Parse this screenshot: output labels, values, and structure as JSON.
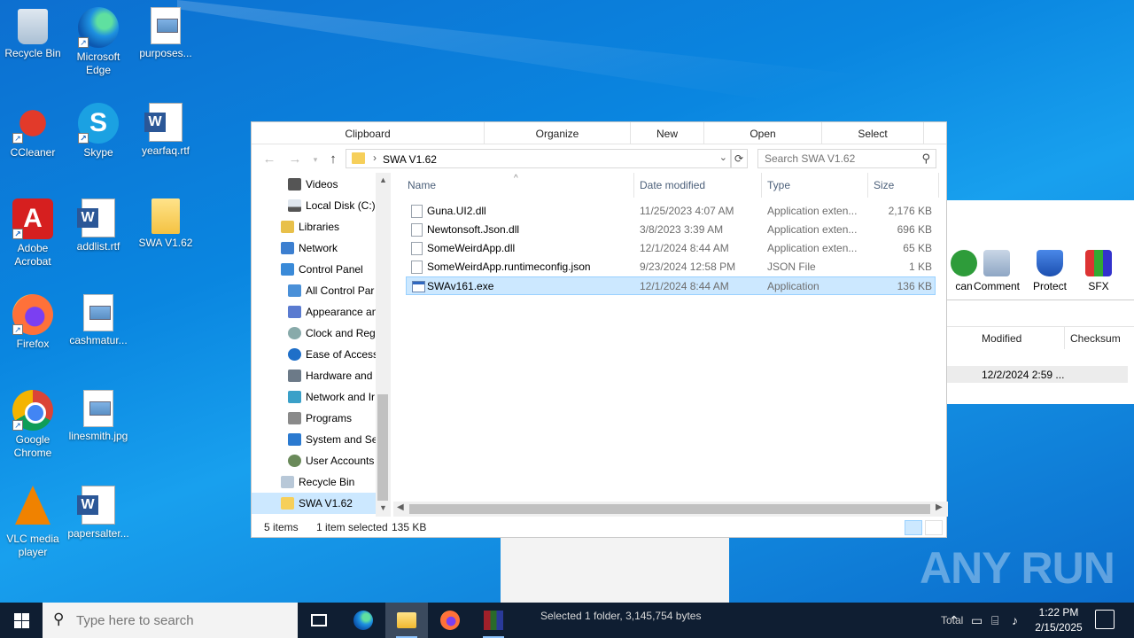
{
  "desktop": {
    "icons": [
      {
        "label": "Recycle Bin"
      },
      {
        "label": "Microsoft Edge"
      },
      {
        "label": "purposes..."
      },
      {
        "label": "CCleaner"
      },
      {
        "label": "Skype"
      },
      {
        "label": "yearfaq.rtf"
      },
      {
        "label": "Adobe Acrobat"
      },
      {
        "label": "addlist.rtf"
      },
      {
        "label": "SWA V1.62"
      },
      {
        "label": "Firefox"
      },
      {
        "label": "cashmatur..."
      },
      {
        "label": "Google Chrome"
      },
      {
        "label": "linesmith.jpg"
      },
      {
        "label": "VLC media player"
      },
      {
        "label": "papersalter..."
      }
    ]
  },
  "background_window": {
    "tools": [
      {
        "label": "can"
      },
      {
        "label": "Comment"
      },
      {
        "label": "Protect"
      },
      {
        "label": "SFX"
      }
    ],
    "columns": {
      "modified": "Modified",
      "checksum": "Checksum"
    },
    "row_modified": "12/2/2024 2:59 ...",
    "taskbar_status": "Selected 1 folder, 3,145,754 bytes",
    "taskbar_partial": "Total"
  },
  "explorer": {
    "ribbon_groups": [
      "Clipboard",
      "Organize",
      "New",
      "Open",
      "Select"
    ],
    "address": {
      "path": "SWA V1.62",
      "separator": "›"
    },
    "search": {
      "placeholder": "Search SWA V1.62"
    },
    "nav_items": [
      {
        "label": "Videos"
      },
      {
        "label": "Local Disk (C:)"
      },
      {
        "label": "Libraries"
      },
      {
        "label": "Network"
      },
      {
        "label": "Control Panel"
      },
      {
        "label": "All Control Par"
      },
      {
        "label": "Appearance an"
      },
      {
        "label": "Clock and Regi"
      },
      {
        "label": "Ease of Access"
      },
      {
        "label": "Hardware and"
      },
      {
        "label": "Network and Ir"
      },
      {
        "label": "Programs"
      },
      {
        "label": "System and Sec"
      },
      {
        "label": "User Accounts"
      },
      {
        "label": "Recycle Bin"
      },
      {
        "label": "SWA V1.62"
      }
    ],
    "columns": {
      "name": "Name",
      "date": "Date modified",
      "type": "Type",
      "size": "Size"
    },
    "files": [
      {
        "name": "Guna.UI2.dll",
        "date": "11/25/2023 4:07 AM",
        "type": "Application exten...",
        "size": "2,176 KB",
        "kind": "dll"
      },
      {
        "name": "Newtonsoft.Json.dll",
        "date": "3/8/2023 3:39 AM",
        "type": "Application exten...",
        "size": "696 KB",
        "kind": "dll"
      },
      {
        "name": "SomeWeirdApp.dll",
        "date": "12/1/2024 8:44 AM",
        "type": "Application exten...",
        "size": "65 KB",
        "kind": "dll"
      },
      {
        "name": "SomeWeirdApp.runtimeconfig.json",
        "date": "9/23/2024 12:58 PM",
        "type": "JSON File",
        "size": "1 KB",
        "kind": "json"
      },
      {
        "name": "SWAv161.exe",
        "date": "12/1/2024 8:44 AM",
        "type": "Application",
        "size": "136 KB",
        "kind": "exe",
        "selected": true
      }
    ],
    "status": {
      "items": "5 items",
      "selected": "1 item selected",
      "size": "135 KB"
    }
  },
  "watermark": "ANY RUN",
  "taskbar": {
    "search_placeholder": "Type here to search",
    "time": "1:22 PM",
    "date": "2/15/2025"
  },
  "colors": {
    "selection": "#cce8ff",
    "taskbar": "#0f1e32",
    "desktop": "#0a86e0"
  }
}
